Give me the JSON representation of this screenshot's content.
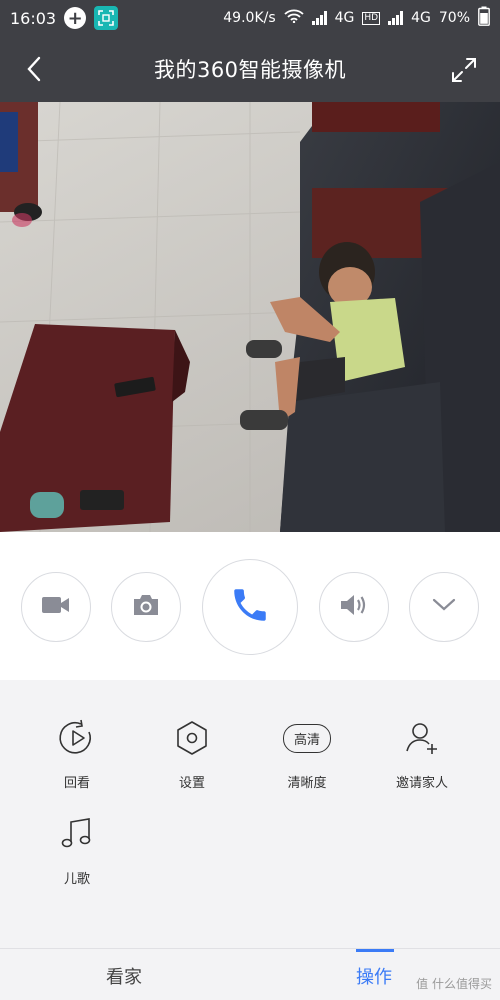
{
  "status_bar": {
    "time": "16:03",
    "net_speed": "49.0K/s",
    "network1": "4G",
    "network2": "4G",
    "battery": "70%"
  },
  "header": {
    "title": "我的360智能摄像机"
  },
  "controls": {
    "record_icon": "video-camera-icon",
    "snapshot_icon": "camera-icon",
    "call_icon": "phone-icon",
    "sound_icon": "speaker-icon",
    "more_icon": "chevron-down-icon",
    "accent": "#3b7bf6"
  },
  "tools": [
    {
      "label": "回看",
      "icon": "playback-icon"
    },
    {
      "label": "设置",
      "icon": "hexagon-settings-icon"
    },
    {
      "label": "清晰度",
      "icon": "hd-badge-icon",
      "badge": "高清"
    },
    {
      "label": "邀请家人",
      "icon": "add-user-icon"
    },
    {
      "label": "儿歌",
      "icon": "music-note-icon"
    }
  ],
  "tabs": [
    {
      "label": "看家",
      "active": false
    },
    {
      "label": "操作",
      "active": true
    }
  ],
  "watermark": "值 什么值得买"
}
